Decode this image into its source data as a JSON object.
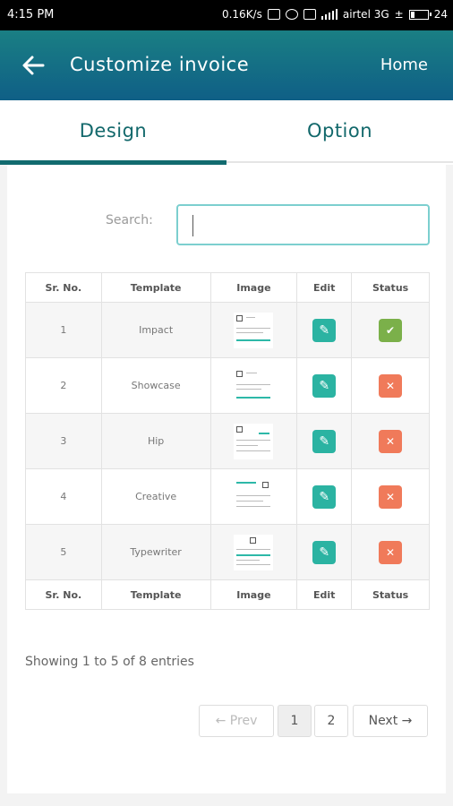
{
  "status_bar": {
    "time": "4:15 PM",
    "speed": "0.16K/s",
    "carrier": "airtel 3G",
    "battery": "24"
  },
  "app_bar": {
    "title": "Customize invoice",
    "home_label": "Home"
  },
  "tabs": [
    {
      "label": "Design",
      "active": true
    },
    {
      "label": "Option",
      "active": false
    }
  ],
  "search": {
    "label": "Search:",
    "value": "",
    "placeholder": ""
  },
  "table": {
    "headers": [
      "Sr. No.",
      "Template",
      "Image",
      "Edit",
      "Status"
    ],
    "rows": [
      {
        "sr": "1",
        "template": "Impact",
        "status": "active"
      },
      {
        "sr": "2",
        "template": "Showcase",
        "status": "inactive"
      },
      {
        "sr": "3",
        "template": "Hip",
        "status": "inactive"
      },
      {
        "sr": "4",
        "template": "Creative",
        "status": "inactive"
      },
      {
        "sr": "5",
        "template": "Typewriter",
        "status": "inactive"
      }
    ]
  },
  "entries_text": "Showing 1 to 5 of 8 entries",
  "pagination": {
    "prev": "← Prev",
    "pages": [
      "1",
      "2"
    ],
    "current": "1",
    "next": "Next →"
  },
  "colors": {
    "accent": "#126b6f",
    "edit": "#2bb3a2",
    "status_on": "#7bb04a",
    "status_off": "#f07a5a"
  }
}
